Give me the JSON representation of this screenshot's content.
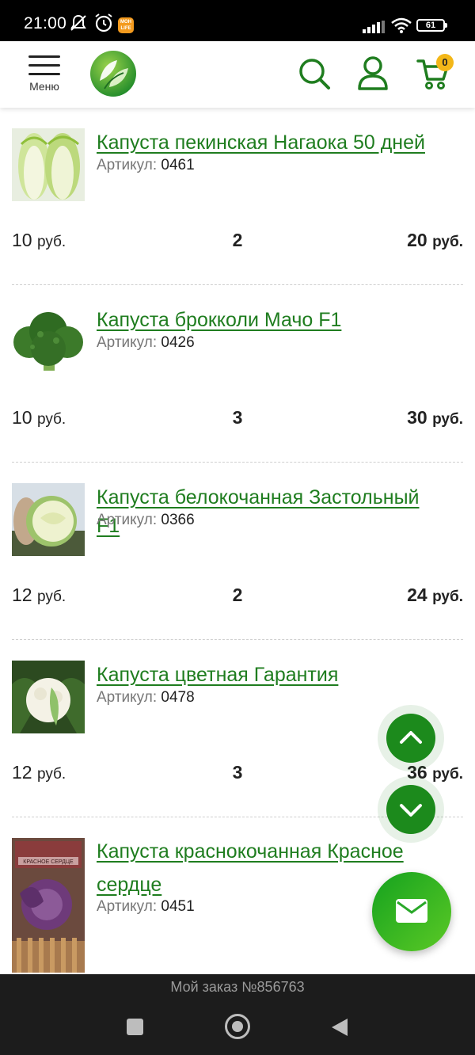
{
  "status_bar": {
    "time": "21:00",
    "battery": "61",
    "app_badge": "MOH LIFE"
  },
  "header": {
    "menu_label": "Меню",
    "cart_count": "0"
  },
  "products": [
    {
      "name": "Капуста пекинская Нагаока 50 дней",
      "article_label": "Артикул:",
      "article": "0461",
      "price": "10",
      "price_unit": "руб.",
      "qty": "2",
      "total": "20",
      "total_unit": "руб."
    },
    {
      "name": "Капуста брокколи Мачо F1",
      "article_label": "Артикул:",
      "article": "0426",
      "price": "10",
      "price_unit": "руб.",
      "qty": "3",
      "total": "30",
      "total_unit": "руб."
    },
    {
      "name": "Капуста белокочанная Застольный F1",
      "article_label": "Артикул:",
      "article": "0366",
      "price": "12",
      "price_unit": "руб.",
      "qty": "2",
      "total": "24",
      "total_unit": "руб."
    },
    {
      "name": "Капуста цветная Гарантия",
      "article_label": "Артикул:",
      "article": "0478",
      "price": "12",
      "price_unit": "руб.",
      "qty": "3",
      "total": "36",
      "total_unit": "руб."
    },
    {
      "name": "Капуста краснокочанная Красное сердце",
      "article_label": "Артикул:",
      "article": "0451"
    }
  ],
  "package_label": {
    "line1": "КРАСНОЕ СЕРДЦЕ"
  },
  "order_bar": {
    "text": "Мой заказ №856763"
  },
  "colors": {
    "brand_green": "#1f7d1f",
    "fab_green": "#1c8a1c",
    "badge_yellow": "#f3b718"
  },
  "icons": [
    "mute-icon",
    "alarm-icon",
    "signal-icon",
    "wifi-icon",
    "battery-icon",
    "hamburger-icon",
    "logo-leaf-icon",
    "search-icon",
    "user-icon",
    "cart-icon",
    "chevron-up-icon",
    "chevron-down-icon",
    "mail-icon",
    "recent-apps-icon",
    "home-icon",
    "back-icon"
  ]
}
